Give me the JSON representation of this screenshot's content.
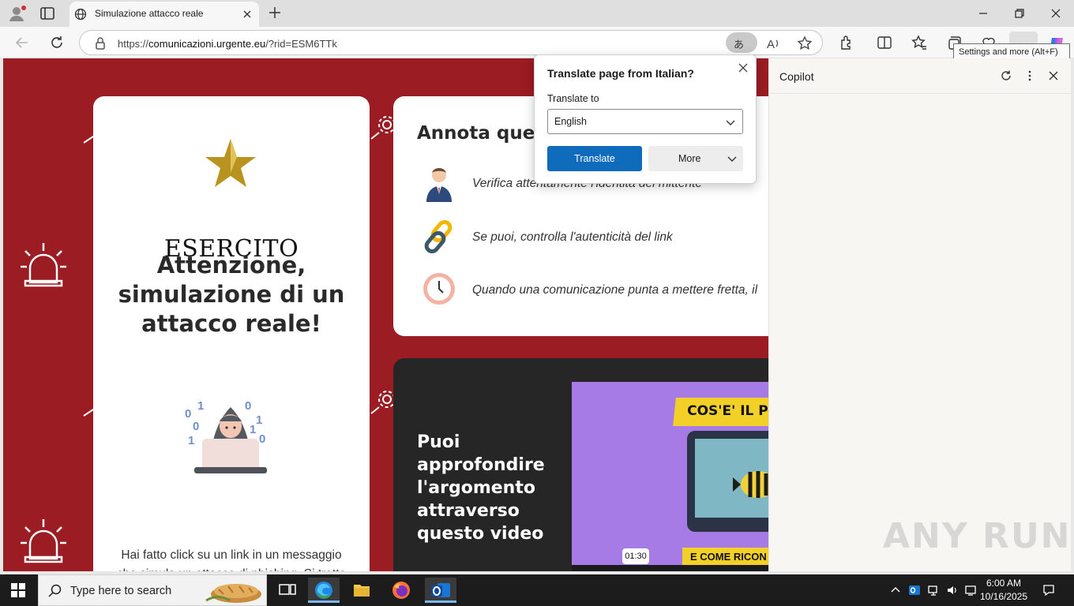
{
  "browser": {
    "tab_title": "Simulazione attacco reale",
    "url_prefix": "https://",
    "url_host": "comunicazioni.urgente.eu",
    "url_path": "/?rid=ESM6TTk",
    "translate_pill": "あ",
    "read_aloud_glyph": "A",
    "tooltip": "Settings and more (Alt+F)"
  },
  "translate_popup": {
    "title": "Translate page from Italian?",
    "label": "Translate to",
    "selected_language": "English",
    "translate_button": "Translate",
    "more_button": "More"
  },
  "page": {
    "brand": "ESERCITO",
    "alert_title": "Attenzione, simulazione di un attacco reale!",
    "body_text": "Hai fatto click su un link in un messaggio che simula un attacco di phishing. Si tratta di un'esercitazione per accrescere",
    "tips_title": "Annota quest",
    "tips": [
      {
        "icon": "businessman-icon",
        "text": "Verifica attentamente l'identità del mittente"
      },
      {
        "icon": "chain-link-icon",
        "text": "Se puoi, controlla l'autenticità del link"
      },
      {
        "icon": "clock-icon",
        "text": "Quando una comunicazione punta a mettere fretta, il"
      }
    ],
    "video_text": "Puoi approfondire l'argomento attraverso questo video",
    "video_banner_top": "COS'E' IL PH",
    "video_banner_bottom": "E COME RICON",
    "video_time": "01:30",
    "hacker_digits": [
      "0",
      "1",
      "0",
      "0",
      "1",
      "1",
      "1",
      "0"
    ]
  },
  "copilot": {
    "title": "Copilot",
    "watermark": "ANY RUN"
  },
  "taskbar": {
    "search_placeholder": "Type here to search",
    "time": "6:00 AM",
    "date": "10/16/2025"
  },
  "colors": {
    "page_background": "#9b1c22",
    "translate_button": "#0f6cbd",
    "star_gold": "#b8931f"
  }
}
